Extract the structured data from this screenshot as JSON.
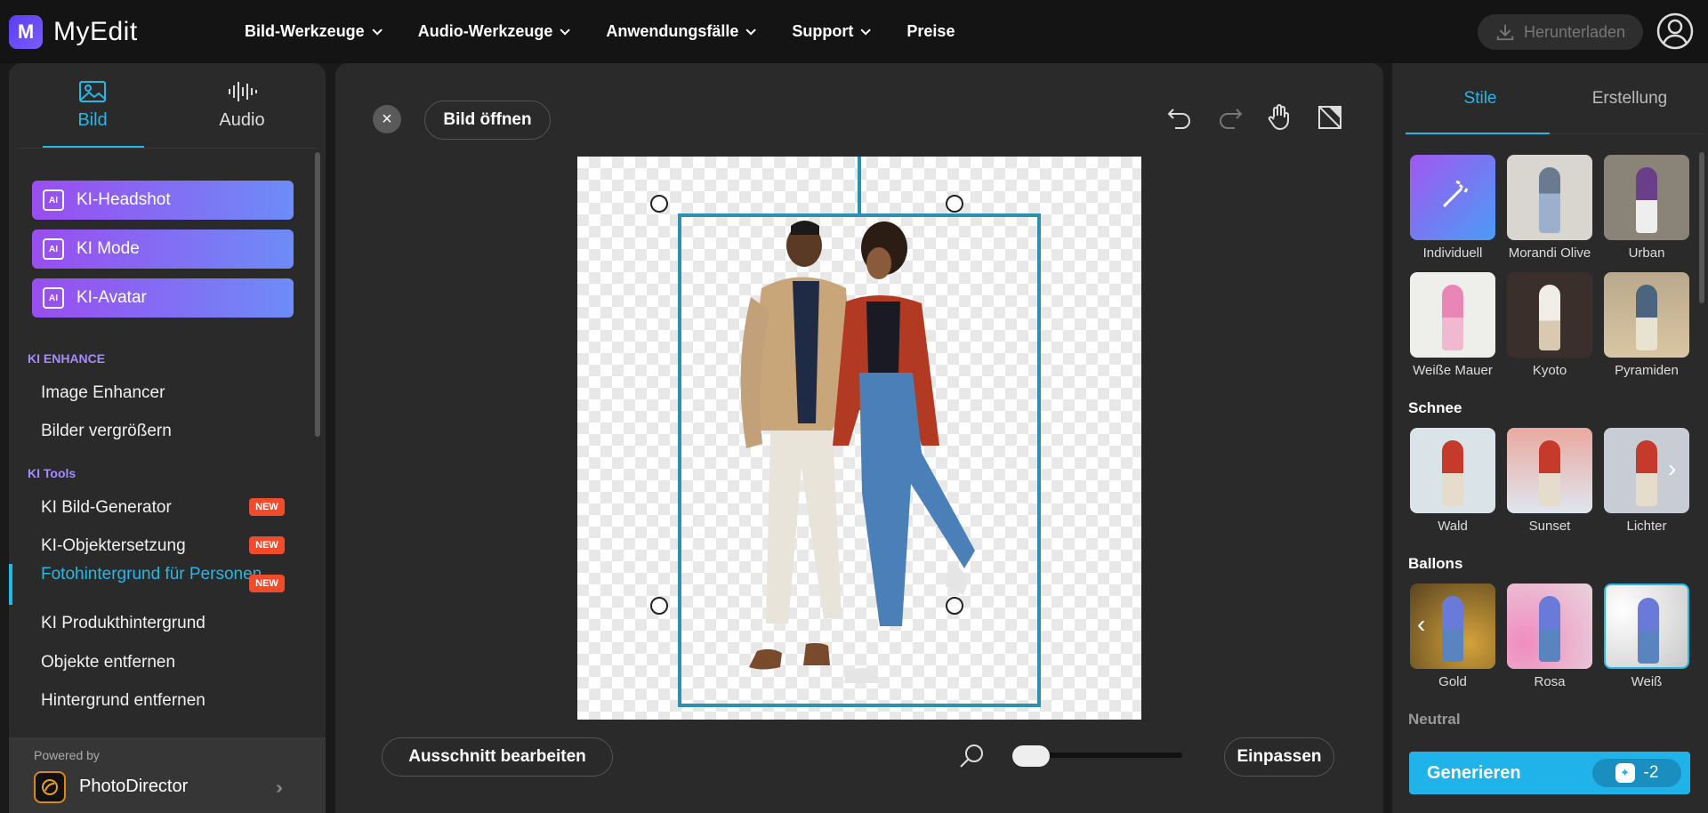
{
  "app": {
    "name": "MyEdit"
  },
  "nav": {
    "items": [
      {
        "label": "Bild-Werkzeuge",
        "dropdown": true
      },
      {
        "label": "Audio-Werkzeuge",
        "dropdown": true
      },
      {
        "label": "Anwendungsfälle",
        "dropdown": true
      },
      {
        "label": "Support",
        "dropdown": true
      },
      {
        "label": "Preise",
        "dropdown": false
      }
    ],
    "download_label": "Herunterladen"
  },
  "sidebar": {
    "tabs": [
      {
        "label": "Bild",
        "icon": "image-icon",
        "active": true
      },
      {
        "label": "Audio",
        "icon": "waveform-icon",
        "active": false
      }
    ],
    "ai_buttons": [
      {
        "label": "KI-Headshot",
        "icon": "ai-sparkle-icon"
      },
      {
        "label": "KI Mode",
        "icon": "ai-sparkle-icon"
      },
      {
        "label": "KI-Avatar",
        "icon": "ai-sparkle-icon"
      }
    ],
    "section_enhance": "KI ENHANCE",
    "enhance_items": [
      "Image Enhancer",
      "Bilder vergrößern"
    ],
    "section_tools": "KI Tools",
    "tool_items": [
      {
        "label": "KI Bild-Generator",
        "badge": "NEW"
      },
      {
        "label": "KI-Objektersetzung",
        "badge": "NEW"
      },
      {
        "label": "Fotohintergrund für Personen",
        "badge": "NEW",
        "active": true
      },
      {
        "label": "KI Produkthintergrund",
        "badge": ""
      },
      {
        "label": "Objekte entfernen",
        "badge": ""
      },
      {
        "label": "Hintergrund entfernen",
        "badge": ""
      }
    ],
    "powered_by": "Powered by",
    "powered_product": "PhotoDirector"
  },
  "editor": {
    "open_image_label": "Bild öffnen",
    "edit_crop_label": "Ausschnitt bearbeiten",
    "fit_label": "Einpassen",
    "zoom_level": 0.1
  },
  "styles_panel": {
    "tabs": [
      {
        "label": "Stile",
        "active": true
      },
      {
        "label": "Erstellung",
        "active": false
      }
    ],
    "styles": [
      {
        "label": "Individuell",
        "kind": "custom"
      },
      {
        "label": "Morandi Olive"
      },
      {
        "label": "Urban"
      },
      {
        "label": "Weiße Mauer"
      },
      {
        "label": "Kyoto"
      },
      {
        "label": "Pyramiden"
      }
    ],
    "section_snow": "Schnee",
    "snow": [
      {
        "label": "Wald"
      },
      {
        "label": "Sunset"
      },
      {
        "label": "Lichter"
      }
    ],
    "section_balloons": "Ballons",
    "balloons": [
      {
        "label": "Gold"
      },
      {
        "label": "Rosa"
      },
      {
        "label": "Weiß",
        "selected": true
      }
    ],
    "section_neutral": "Neutral",
    "generate_label": "Generieren",
    "credit_cost": "-2"
  },
  "colors": {
    "accent": "#22b8e8",
    "brand_purple": "#7b5cff",
    "new_badge": "#f24b2a"
  }
}
